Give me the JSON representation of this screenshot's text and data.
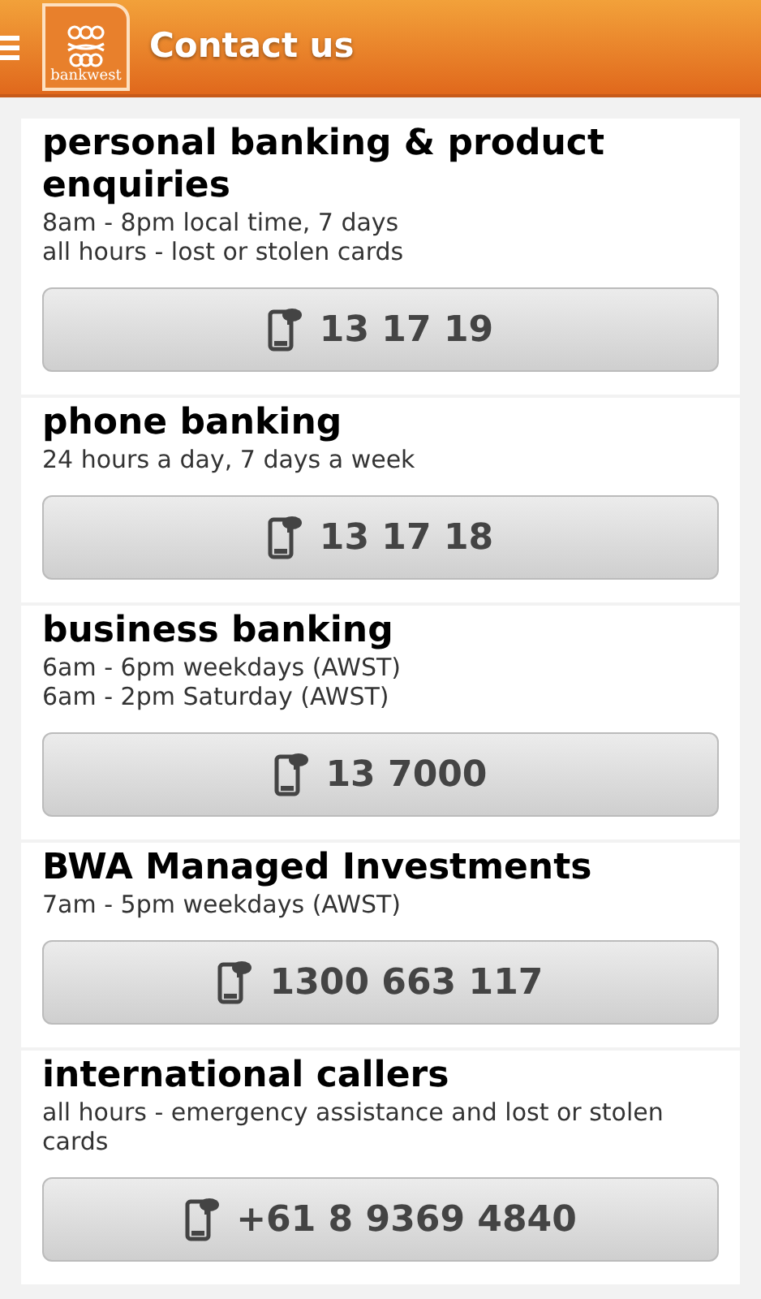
{
  "header": {
    "logo_text": "bankwest",
    "title": "Contact us"
  },
  "contacts": [
    {
      "title": "personal banking & product enquiries",
      "hours": [
        "8am - 8pm local time, 7 days",
        "all hours - lost or stolen cards"
      ],
      "phone": "13 17 19"
    },
    {
      "title": "phone banking",
      "hours": [
        "24 hours a day, 7 days a week"
      ],
      "phone": "13 17 18"
    },
    {
      "title": "business banking",
      "hours": [
        "6am - 6pm weekdays (AWST)",
        "6am - 2pm Saturday (AWST)"
      ],
      "phone": "13 7000"
    },
    {
      "title": "BWA Managed Investments",
      "hours": [
        "7am - 5pm weekdays (AWST)"
      ],
      "phone": "1300 663 117"
    },
    {
      "title": "international callers",
      "hours": [
        "all hours - emergency assistance and lost or stolen cards"
      ],
      "phone": "+61 8 9369 4840"
    }
  ]
}
